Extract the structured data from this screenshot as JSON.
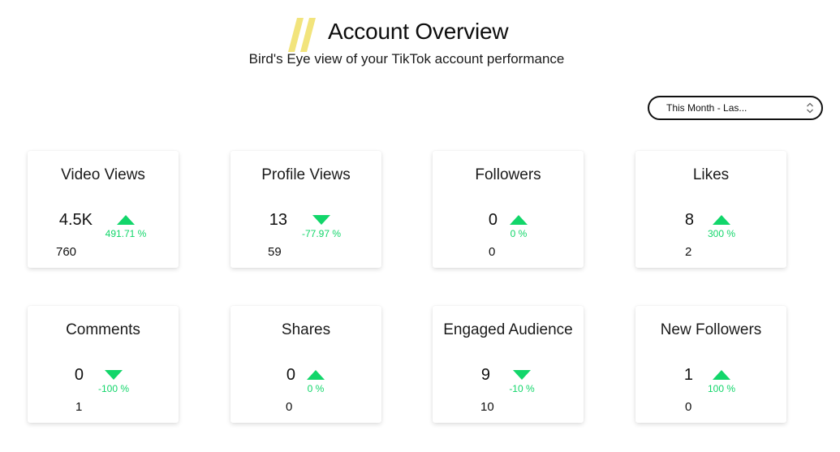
{
  "header": {
    "title": "Account Overview",
    "subtitle": "Bird's Eye view of your TikTok account performance",
    "accent_color": "#f2e47c"
  },
  "date_filter": {
    "value": "This Month - Las..."
  },
  "colors": {
    "positive": "#12d66a",
    "negative": "#12d66a"
  },
  "metrics": [
    {
      "title": "Video Views",
      "value": "4.5K",
      "change": "491.71 %",
      "direction": "up",
      "previous": "760"
    },
    {
      "title": "Profile Views",
      "value": "13",
      "change": "-77.97 %",
      "direction": "down",
      "previous": "59"
    },
    {
      "title": "Followers",
      "value": "0",
      "change": "0 %",
      "direction": "up",
      "previous": "0"
    },
    {
      "title": "Likes",
      "value": "8",
      "change": "300 %",
      "direction": "up",
      "previous": "2"
    },
    {
      "title": "Comments",
      "value": "0",
      "change": "-100 %",
      "direction": "down",
      "previous": "1"
    },
    {
      "title": "Shares",
      "value": "0",
      "change": "0 %",
      "direction": "up",
      "previous": "0"
    },
    {
      "title": "Engaged Audience",
      "value": "9",
      "change": "-10 %",
      "direction": "down",
      "previous": "10"
    },
    {
      "title": "New Followers",
      "value": "1",
      "change": "100 %",
      "direction": "up",
      "previous": "0"
    }
  ]
}
